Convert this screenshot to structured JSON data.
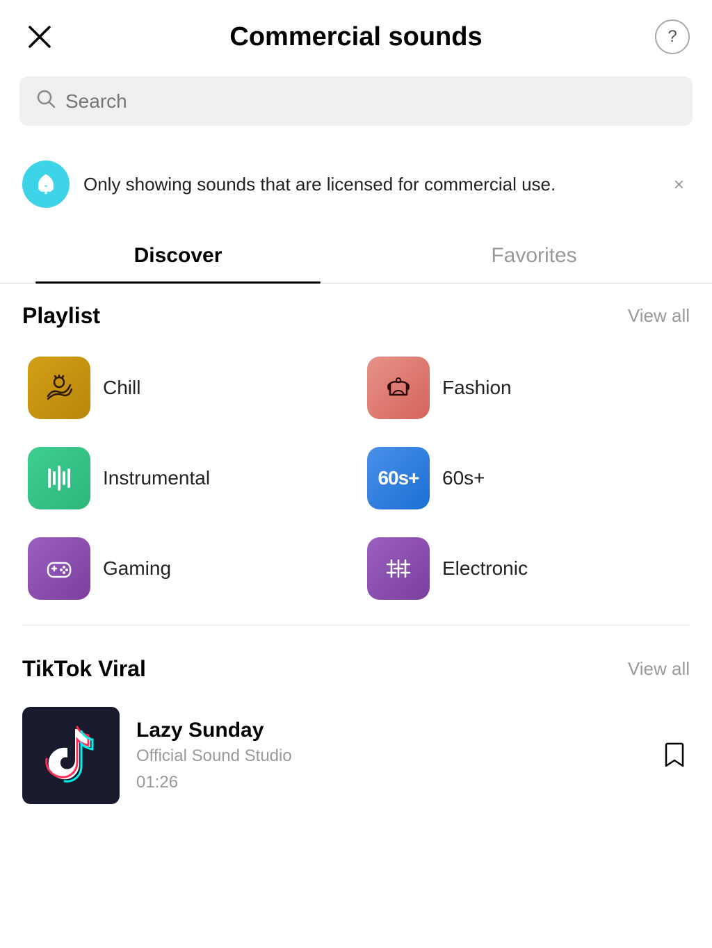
{
  "header": {
    "title": "Commercial sounds",
    "close_label": "×",
    "help_label": "?"
  },
  "search": {
    "placeholder": "Search"
  },
  "notice": {
    "text": "Only showing sounds that are licensed for commercial use.",
    "close_label": "×"
  },
  "tabs": [
    {
      "id": "discover",
      "label": "Discover",
      "active": true
    },
    {
      "id": "favorites",
      "label": "Favorites",
      "active": false
    }
  ],
  "playlist_section": {
    "title": "Playlist",
    "view_all_label": "View all",
    "items": [
      {
        "id": "chill",
        "label": "Chill",
        "icon_style": "chill"
      },
      {
        "id": "fashion",
        "label": "Fashion",
        "icon_style": "fashion"
      },
      {
        "id": "instrumental",
        "label": "Instrumental",
        "icon_style": "instrumental"
      },
      {
        "id": "sixties",
        "label": "60s+",
        "icon_style": "sixties"
      },
      {
        "id": "gaming",
        "label": "Gaming",
        "icon_style": "gaming"
      },
      {
        "id": "electronic",
        "label": "Electronic",
        "icon_style": "electronic"
      }
    ]
  },
  "tiktok_viral": {
    "title": "TikTok Viral",
    "view_all_label": "View all",
    "songs": [
      {
        "id": "lazy-sunday",
        "title": "Lazy Sunday",
        "artist": "Official Sound Studio",
        "duration": "01:26"
      }
    ]
  }
}
